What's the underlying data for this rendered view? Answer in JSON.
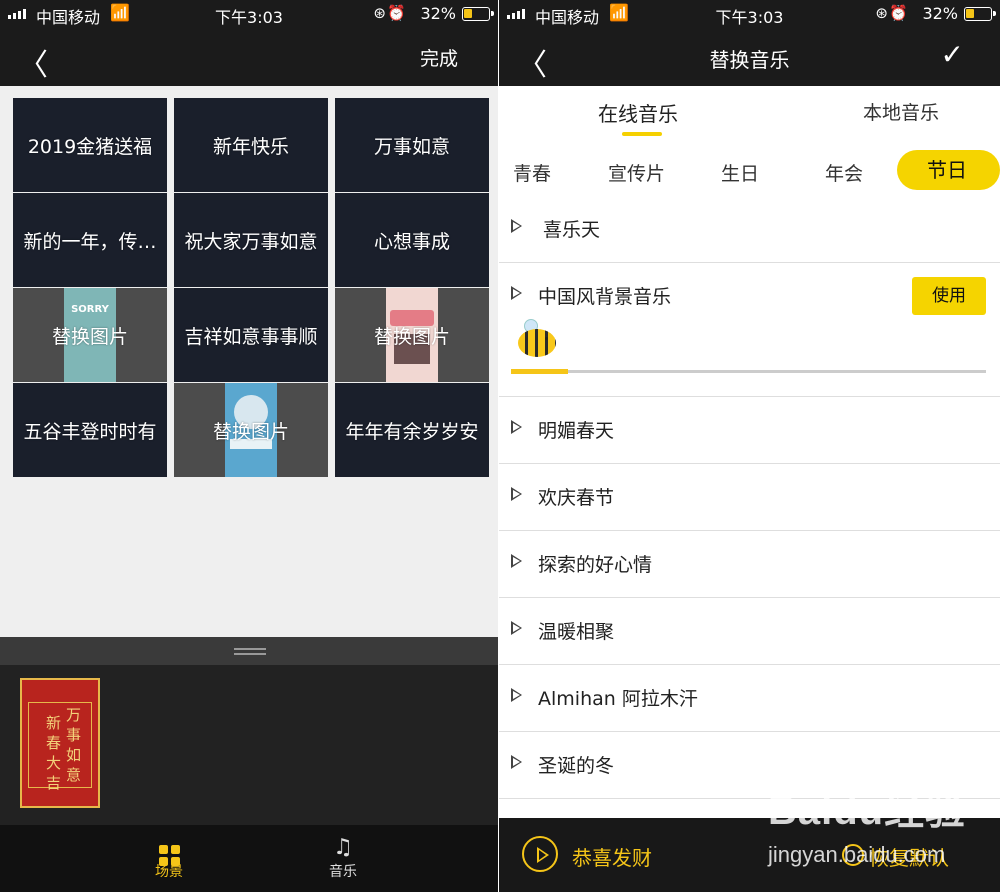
{
  "status": {
    "carrier": "中国移动",
    "time": "下午3:03",
    "battery": "32%"
  },
  "left": {
    "nav": {
      "done_label": "完成"
    },
    "grid": [
      {
        "text": "2019金猪送福",
        "type": "text"
      },
      {
        "text": "新年快乐",
        "type": "text"
      },
      {
        "text": "万事如意",
        "type": "text"
      },
      {
        "text": "新的一年，传…",
        "type": "text"
      },
      {
        "text": "祝大家万事如意",
        "type": "text"
      },
      {
        "text": "心想事成",
        "type": "text"
      },
      {
        "text": "替换图片",
        "type": "image",
        "thumb_text": "SORRY"
      },
      {
        "text": "吉祥如意事事顺",
        "type": "text"
      },
      {
        "text": "替换图片",
        "type": "image"
      },
      {
        "text": "五谷丰登时时有",
        "type": "text"
      },
      {
        "text": "替换图片",
        "type": "image"
      },
      {
        "text": "年年有余岁岁安",
        "type": "text"
      }
    ],
    "preview_chars": [
      "新",
      "春",
      "大",
      "吉",
      "万",
      "事",
      "如",
      "意"
    ],
    "tabs": {
      "scene": "场景",
      "music": "音乐"
    }
  },
  "right": {
    "nav": {
      "title": "替换音乐"
    },
    "source_tabs": {
      "online": "在线音乐",
      "local": "本地音乐"
    },
    "categories": [
      "青春",
      "宣传片",
      "生日",
      "年会",
      "节日"
    ],
    "active_category": "节日",
    "songs": [
      "喜乐天",
      "中国风背景音乐",
      "明媚春天",
      "欢庆春节",
      "探索的好心情",
      "温暖相聚",
      "Almihan 阿拉木汗",
      "圣诞的冬"
    ],
    "use_label": "使用",
    "progress": 0.12,
    "player": {
      "current": "恭喜发财",
      "restore": "恢复默认"
    }
  },
  "watermark": {
    "brand": "Baidu经验",
    "url": "jingyan.baidu.com"
  },
  "colors": {
    "accent": "#f5c518",
    "dark": "#1b1b1b",
    "cell": "#1a1f2b"
  }
}
